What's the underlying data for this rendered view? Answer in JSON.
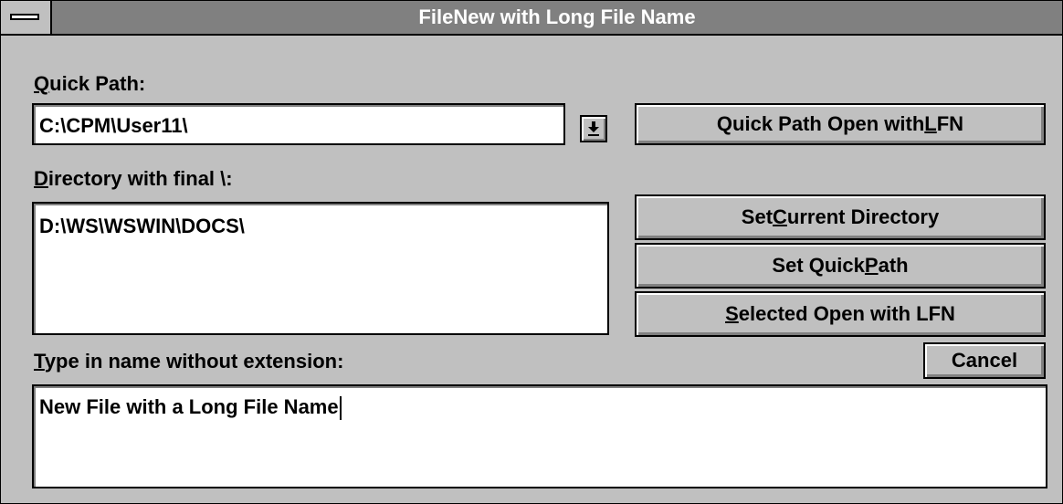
{
  "window": {
    "title": "FileNew with Long File Name"
  },
  "quick_path": {
    "label_mnemonic": "Q",
    "label_rest": "uick Path:",
    "value": "C:\\CPM\\User11\\"
  },
  "directory": {
    "label_mnemonic": "D",
    "label_rest": "irectory with final \\:",
    "value": "D:\\WS\\WSWIN\\DOCS\\"
  },
  "filename": {
    "label_mnemonic": "T",
    "label_rest": "ype in name without extension:",
    "value": "New File with a Long File Name"
  },
  "buttons": {
    "quick_open": {
      "pre": "Quick Path Open with ",
      "mnemonic": "L",
      "post": "FN"
    },
    "set_current_dir": {
      "pre": "Set ",
      "mnemonic": "C",
      "post": "urrent Directory"
    },
    "set_quick_path": {
      "pre": "Set Quick ",
      "mnemonic": "P",
      "post": "ath"
    },
    "selected_open": {
      "pre": "",
      "mnemonic": "S",
      "post": "elected Open with LFN"
    },
    "cancel": {
      "label": "Cancel"
    }
  },
  "icons": {
    "system_menu": "system-menu-icon",
    "dropdown": "dropdown-arrow-icon"
  }
}
